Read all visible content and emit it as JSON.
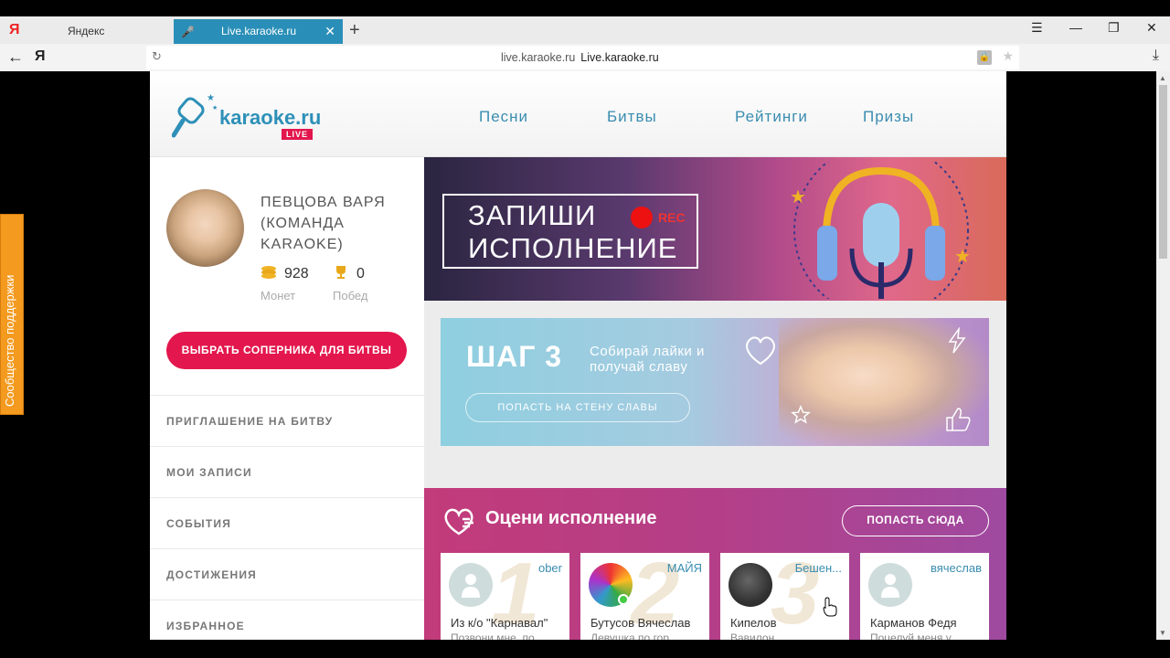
{
  "browser": {
    "logo": "Я",
    "tabs": [
      {
        "label": "Яндекс"
      },
      {
        "label": "Live.karaoke.ru"
      }
    ],
    "new_tab": "+",
    "window_controls": {
      "menu": "☰",
      "minimize": "—",
      "restore": "❐",
      "close": "✕"
    },
    "address": {
      "domain": "live.karaoke.ru",
      "title": "Live.karaoke.ru"
    }
  },
  "site": {
    "logo_text": "karaoke.ru",
    "logo_badge": "LIVE",
    "nav": [
      "Песни",
      "Битвы",
      "Рейтинги",
      "Призы"
    ]
  },
  "profile": {
    "name": "ПЕВЦОВА ВАРЯ (КОМАНДА KARAOKE)",
    "coins": "928",
    "coins_label": "Монет",
    "wins": "0",
    "wins_label": "Побед",
    "battle_button": "ВЫБРАТЬ СОПЕРНИКА ДЛЯ БИТВЫ"
  },
  "side_menu": [
    "ПРИГЛАШЕНИЕ НА БИТВУ",
    "МОИ ЗАПИСИ",
    "СОБЫТИЯ",
    "ДОСТИЖЕНИЯ",
    "ИЗБРАННОЕ"
  ],
  "hero": {
    "line1": "ЗАПИШИ",
    "line2": "ИСПОЛНЕНИЕ",
    "rec": "REC"
  },
  "step": {
    "title": "ШАГ 3",
    "subtitle": "Собирай лайки и получай славу",
    "button": "ПОПАСТЬ НА СТЕНУ СЛАВЫ"
  },
  "rate": {
    "title": "Оцени исполнение",
    "button": "ПОПАСТЬ СЮДА",
    "cards": [
      {
        "num": "1",
        "user": "ober",
        "artist": "Из к/о \"Карнавал\"",
        "song": "Позвони мне, по..."
      },
      {
        "num": "2",
        "user": "МАЙЯ",
        "artist": "Бутусов Вячеслав",
        "song": "Девушка по гор..."
      },
      {
        "num": "3",
        "user": "Бешен...",
        "artist": "Кипелов",
        "song": "Вавилон"
      },
      {
        "num": "",
        "user": "вячеслав",
        "artist": "Карманов Федя",
        "song": "Поцелуй меня у..."
      }
    ]
  },
  "support": "Сообщество поддержки",
  "colors": {
    "accent": "#e3174d",
    "brand": "#2e90b8",
    "support": "#f39a1f"
  }
}
